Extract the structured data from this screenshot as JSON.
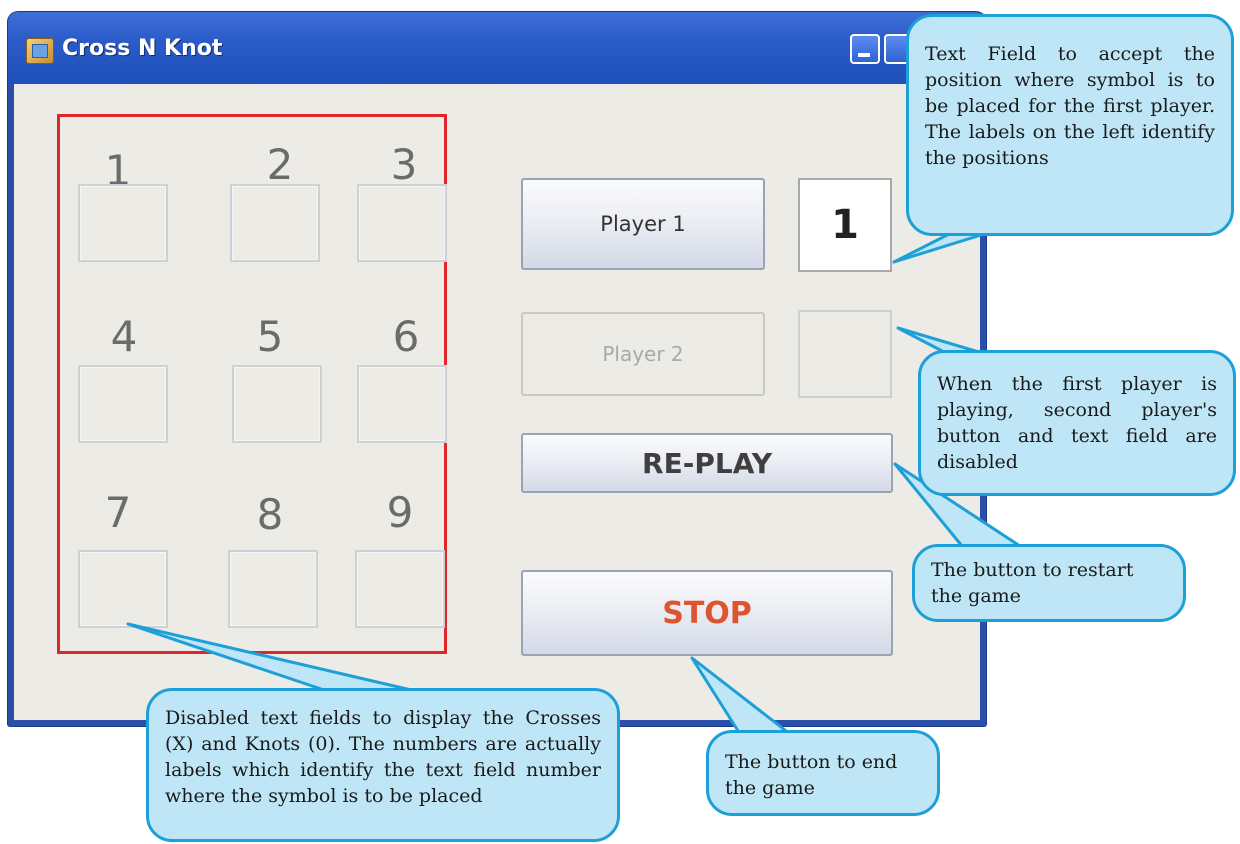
{
  "window": {
    "title": "Cross N Knot",
    "icon": "java-app-icon"
  },
  "board": {
    "labels": [
      "1",
      "2",
      "3",
      "4",
      "5",
      "6",
      "7",
      "8",
      "9"
    ],
    "cells": [
      "",
      "",
      "",
      "",
      "",
      "",
      "",
      "",
      ""
    ]
  },
  "controls": {
    "player1_label": "Player 1",
    "player1_value": "1",
    "player2_label": "Player 2",
    "player2_value": "",
    "replay_label": "RE-PLAY",
    "stop_label": "STOP"
  },
  "callouts": {
    "text_field": "Text Field to accept the position where symbol is to be placed for the first player. The labels on the left identify the positions",
    "disabled": "When the first player is playing, second player's button and text field are disabled",
    "restart": "The button to restart the game",
    "end": "The button to end the game",
    "board": "Disabled text fields to display the Crosses (X) and Knots (0). The numbers are actually labels which identify the text field number where the symbol is to be placed"
  },
  "colors": {
    "stop_text": "#e0532f",
    "board_frame": "#e0262a",
    "callout_fill": "#bfe6f6",
    "callout_border": "#1d9fd8"
  }
}
